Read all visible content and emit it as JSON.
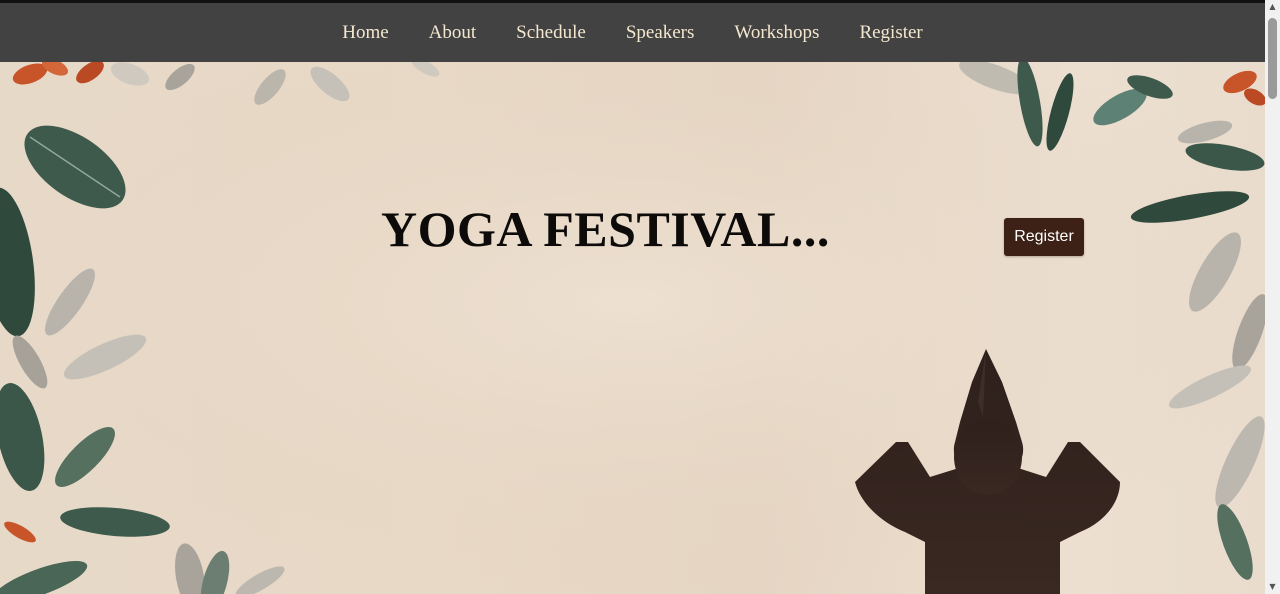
{
  "nav": {
    "items": [
      {
        "label": "Home"
      },
      {
        "label": "About"
      },
      {
        "label": "Schedule"
      },
      {
        "label": "Speakers"
      },
      {
        "label": "Workshops"
      },
      {
        "label": "Register"
      }
    ]
  },
  "hero": {
    "title": "YOGA FESTIVAL...",
    "register_label": "Register",
    "background_icon": "leaves-and-meditating-figure-illustration"
  },
  "colors": {
    "navbar": "#424242",
    "nav_text": "#f4e7cf",
    "hero_bg": "#e8d8c6",
    "button": "#3d2116",
    "leaf_green": "#3e5a4c",
    "leaf_grey": "#b9b4ab",
    "flower_orange": "#c8542a"
  },
  "scrollbar": {
    "up_icon": "scroll-up-arrow-icon",
    "down_icon": "scroll-down-arrow-icon"
  }
}
